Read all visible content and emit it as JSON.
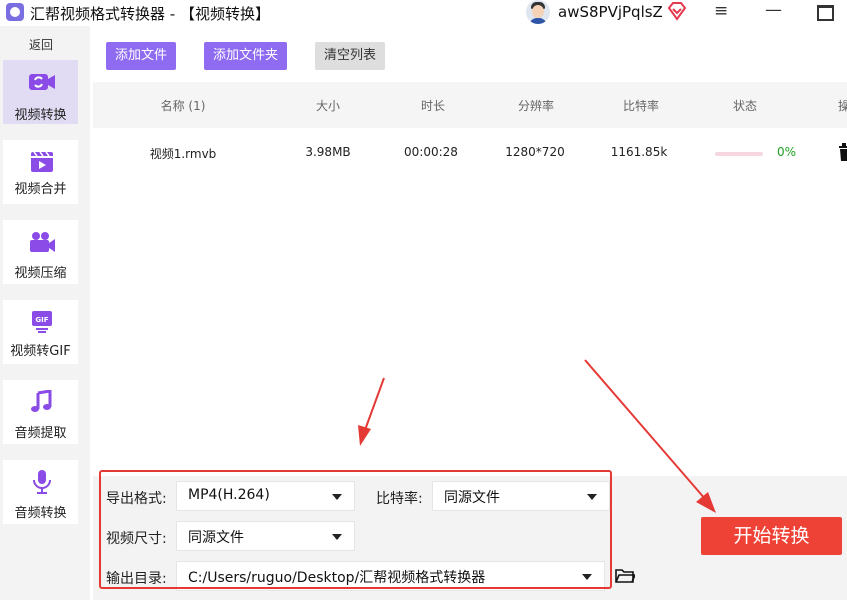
{
  "titlebar": {
    "title": "汇帮视频格式转换器  - 【视频转换】",
    "username": "awS8PVjPqlsZ",
    "menu_glyph": "≡",
    "min_glyph": "—"
  },
  "sidebar": {
    "back_label": "返回",
    "items": [
      {
        "label": "视频转换",
        "icon": "video-convert-icon",
        "active": true
      },
      {
        "label": "视频合并",
        "icon": "video-merge-icon",
        "active": false
      },
      {
        "label": "视频压缩",
        "icon": "video-compress-icon",
        "active": false
      },
      {
        "label": "视频转GIF",
        "icon": "gif-icon",
        "active": false
      },
      {
        "label": "音频提取",
        "icon": "music-note-icon",
        "active": false
      },
      {
        "label": "音频转换",
        "icon": "microphone-icon",
        "active": false
      }
    ]
  },
  "toolbar": {
    "add_file": "添加文件",
    "add_folder": "添加文件夹",
    "clear_list": "清空列表"
  },
  "table": {
    "headers": [
      "名称 (1)",
      "大小",
      "时长",
      "分辨率",
      "比特率",
      "状态",
      "操"
    ],
    "rows": [
      {
        "name": "视频1.rmvb",
        "size": "3.98MB",
        "duration": "00:00:28",
        "resolution": "1280*720",
        "bitrate": "1161.85k",
        "progress": "0%"
      }
    ]
  },
  "settings": {
    "format_label": "导出格式:",
    "format_value": "MP4(H.264)",
    "bitrate_label": "比特率:",
    "bitrate_value": "同源文件",
    "size_label": "视频尺寸:",
    "size_value": "同源文件",
    "output_label": "输出目录:",
    "output_value": "C:/Users/ruguo/Desktop/汇帮视频格式转换器"
  },
  "start_button": "开始转换",
  "colors": {
    "accent": "#8e6bf0",
    "active_nav": "#e1dcf3",
    "start": "#ef4236",
    "annotation": "#e53935",
    "status_green": "#20a020"
  }
}
